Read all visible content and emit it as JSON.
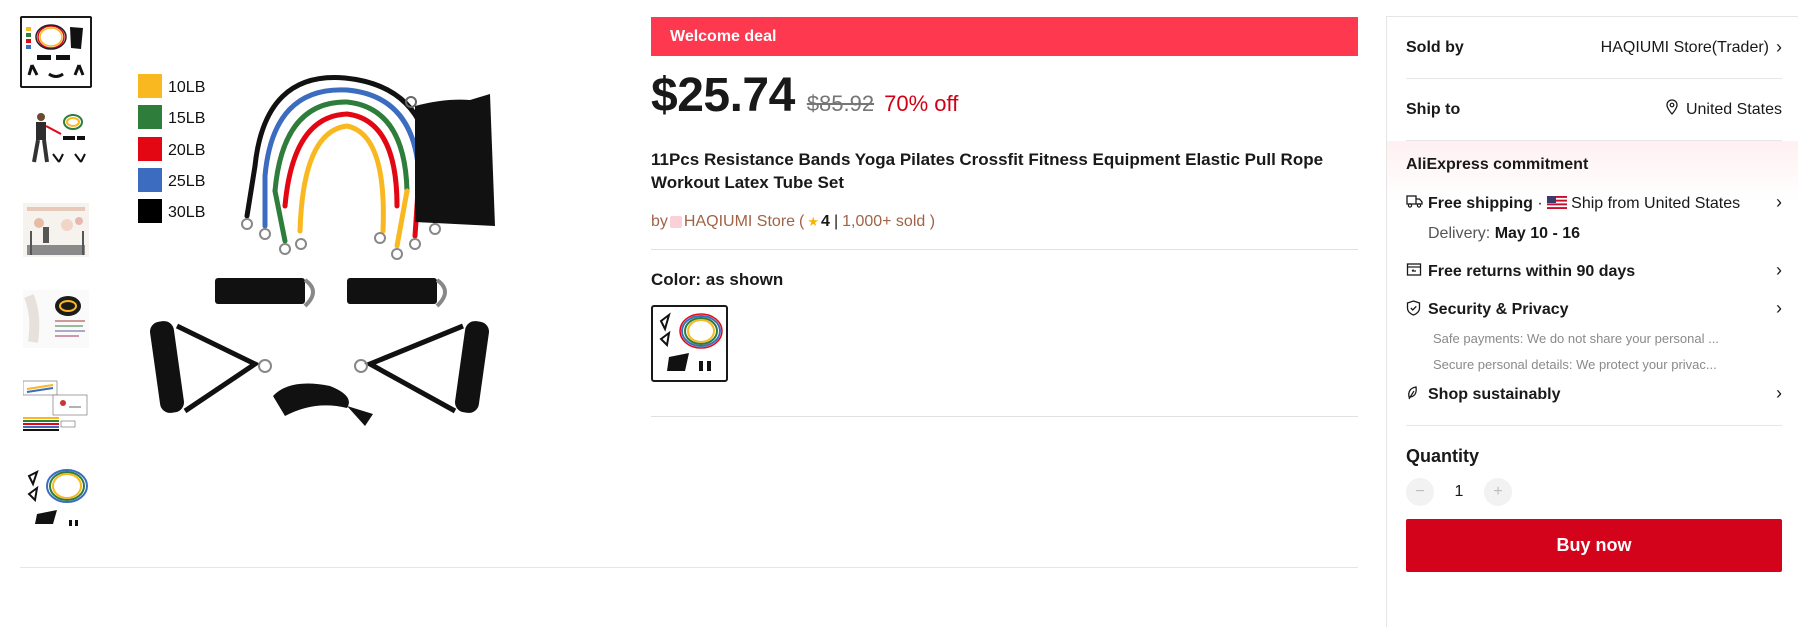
{
  "thumbnails": [
    {
      "name": "thumbnail-bands-set",
      "active": true
    },
    {
      "name": "thumbnail-person-exercising"
    },
    {
      "name": "thumbnail-gym-scene"
    },
    {
      "name": "thumbnail-bag-detail"
    },
    {
      "name": "thumbnail-infographic"
    },
    {
      "name": "thumbnail-bands-layout"
    }
  ],
  "main_image": {
    "weights": [
      {
        "label": "10LB",
        "color": "#f9b820"
      },
      {
        "label": "15LB",
        "color": "#2e7d3a"
      },
      {
        "label": "20LB",
        "color": "#e30613"
      },
      {
        "label": "25LB",
        "color": "#3b6cc0"
      },
      {
        "label": "30LB",
        "color": "#000000"
      }
    ]
  },
  "product": {
    "welcome_label": "Welcome deal",
    "price": "$25.74",
    "original_price": "$85.92",
    "discount": "70% off",
    "title": "11Pcs Resistance Bands Yoga Pilates Crossfit Fitness Equipment Elastic Pull Rope Workout Latex Tube Set",
    "store": {
      "prefix": "by",
      "name": "HAQIUMI Store",
      "open_paren": "(",
      "rating": "4",
      "separator": "|",
      "sold": "1,000+ sold )"
    },
    "color": {
      "label": "Color: as shown"
    }
  },
  "panel": {
    "sold_by_label": "Sold by",
    "sold_by_value": "HAQIUMI Store(Trader)",
    "ship_to_label": "Ship to",
    "ship_to_value": "United States",
    "commitment_title": "AliExpress commitment",
    "free_shipping": "Free shipping",
    "ship_from_sep": "·",
    "ship_from": "Ship from United States",
    "delivery_label": "Delivery:",
    "delivery_dates": "May 10 - 16",
    "free_returns": "Free returns within 90 days",
    "security_title": "Security & Privacy",
    "security_note_1": "Safe payments: We do not share your personal ...",
    "security_note_2": "Secure personal details: We protect your privac...",
    "sustainable": "Shop sustainably",
    "quantity_label": "Quantity",
    "quantity_minus": "−",
    "quantity_value": "1",
    "quantity_plus": "+",
    "buy_now": "Buy now"
  },
  "colors": {
    "welcome_bg": "#fd384f",
    "discount": "#d20015",
    "buy_button": "#d3031c",
    "store_link": "#a06346"
  },
  "icons": [
    "truck-icon",
    "return-box-icon",
    "shield-icon",
    "leaf-icon",
    "location-pin-icon",
    "chevron-right-icon",
    "star-icon",
    "us-flag-icon"
  ]
}
